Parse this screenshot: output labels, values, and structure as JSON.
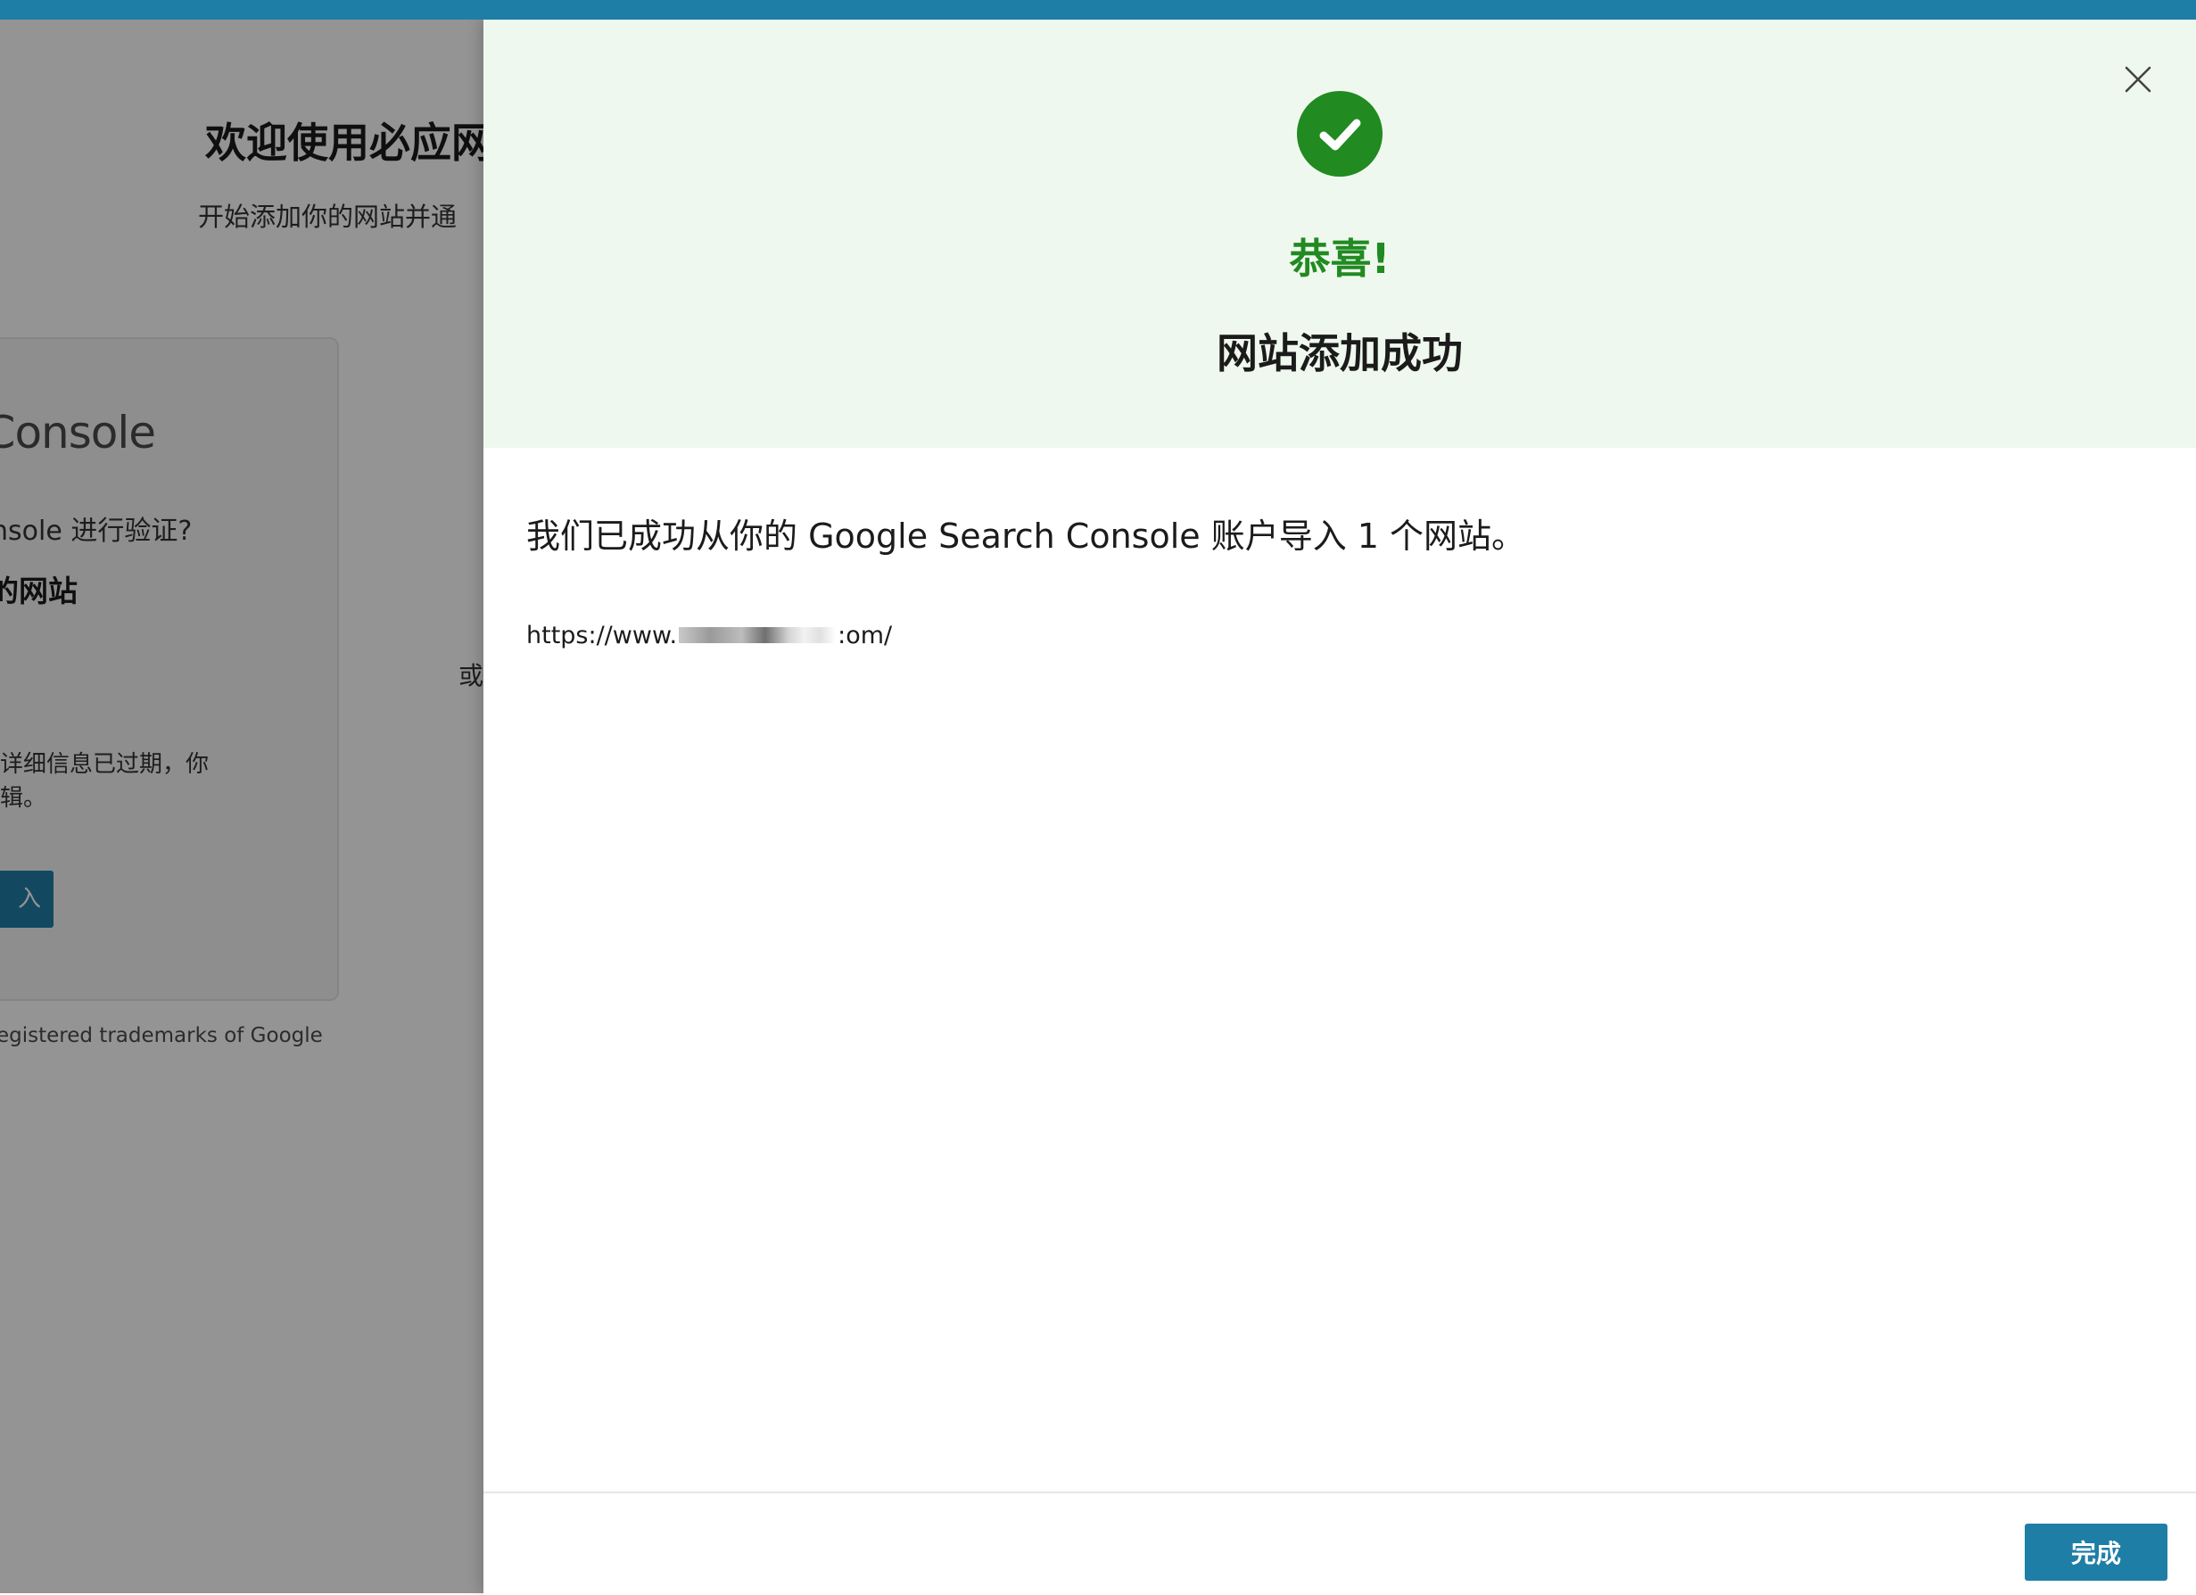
{
  "colors": {
    "accent": "#1f7ea6",
    "success_green": "#218a21",
    "header_bg": "#eff8ef"
  },
  "background_page": {
    "title": "欢迎使用必应网",
    "subtitle": "开始添加你的网站并通",
    "card": {
      "logo_text": "rch Console",
      "question": "rch Console 进行验证?",
      "heading": "入你的网站",
      "description": "详细信息已过期，你\n辑。",
      "button_label": "入"
    },
    "or_label": "或",
    "footer_text": "egistered trademarks of Google"
  },
  "panel": {
    "close_icon": "close-icon",
    "success_icon": "check-circle-icon",
    "congrats": "恭喜!",
    "heading": "网站添加成功",
    "import_message": "我们已成功从你的 Google Search Console 账户导入 1 个网站。",
    "site": {
      "url_prefix": "https://www.",
      "url_suffix": ":om/"
    },
    "done_label": "完成"
  }
}
